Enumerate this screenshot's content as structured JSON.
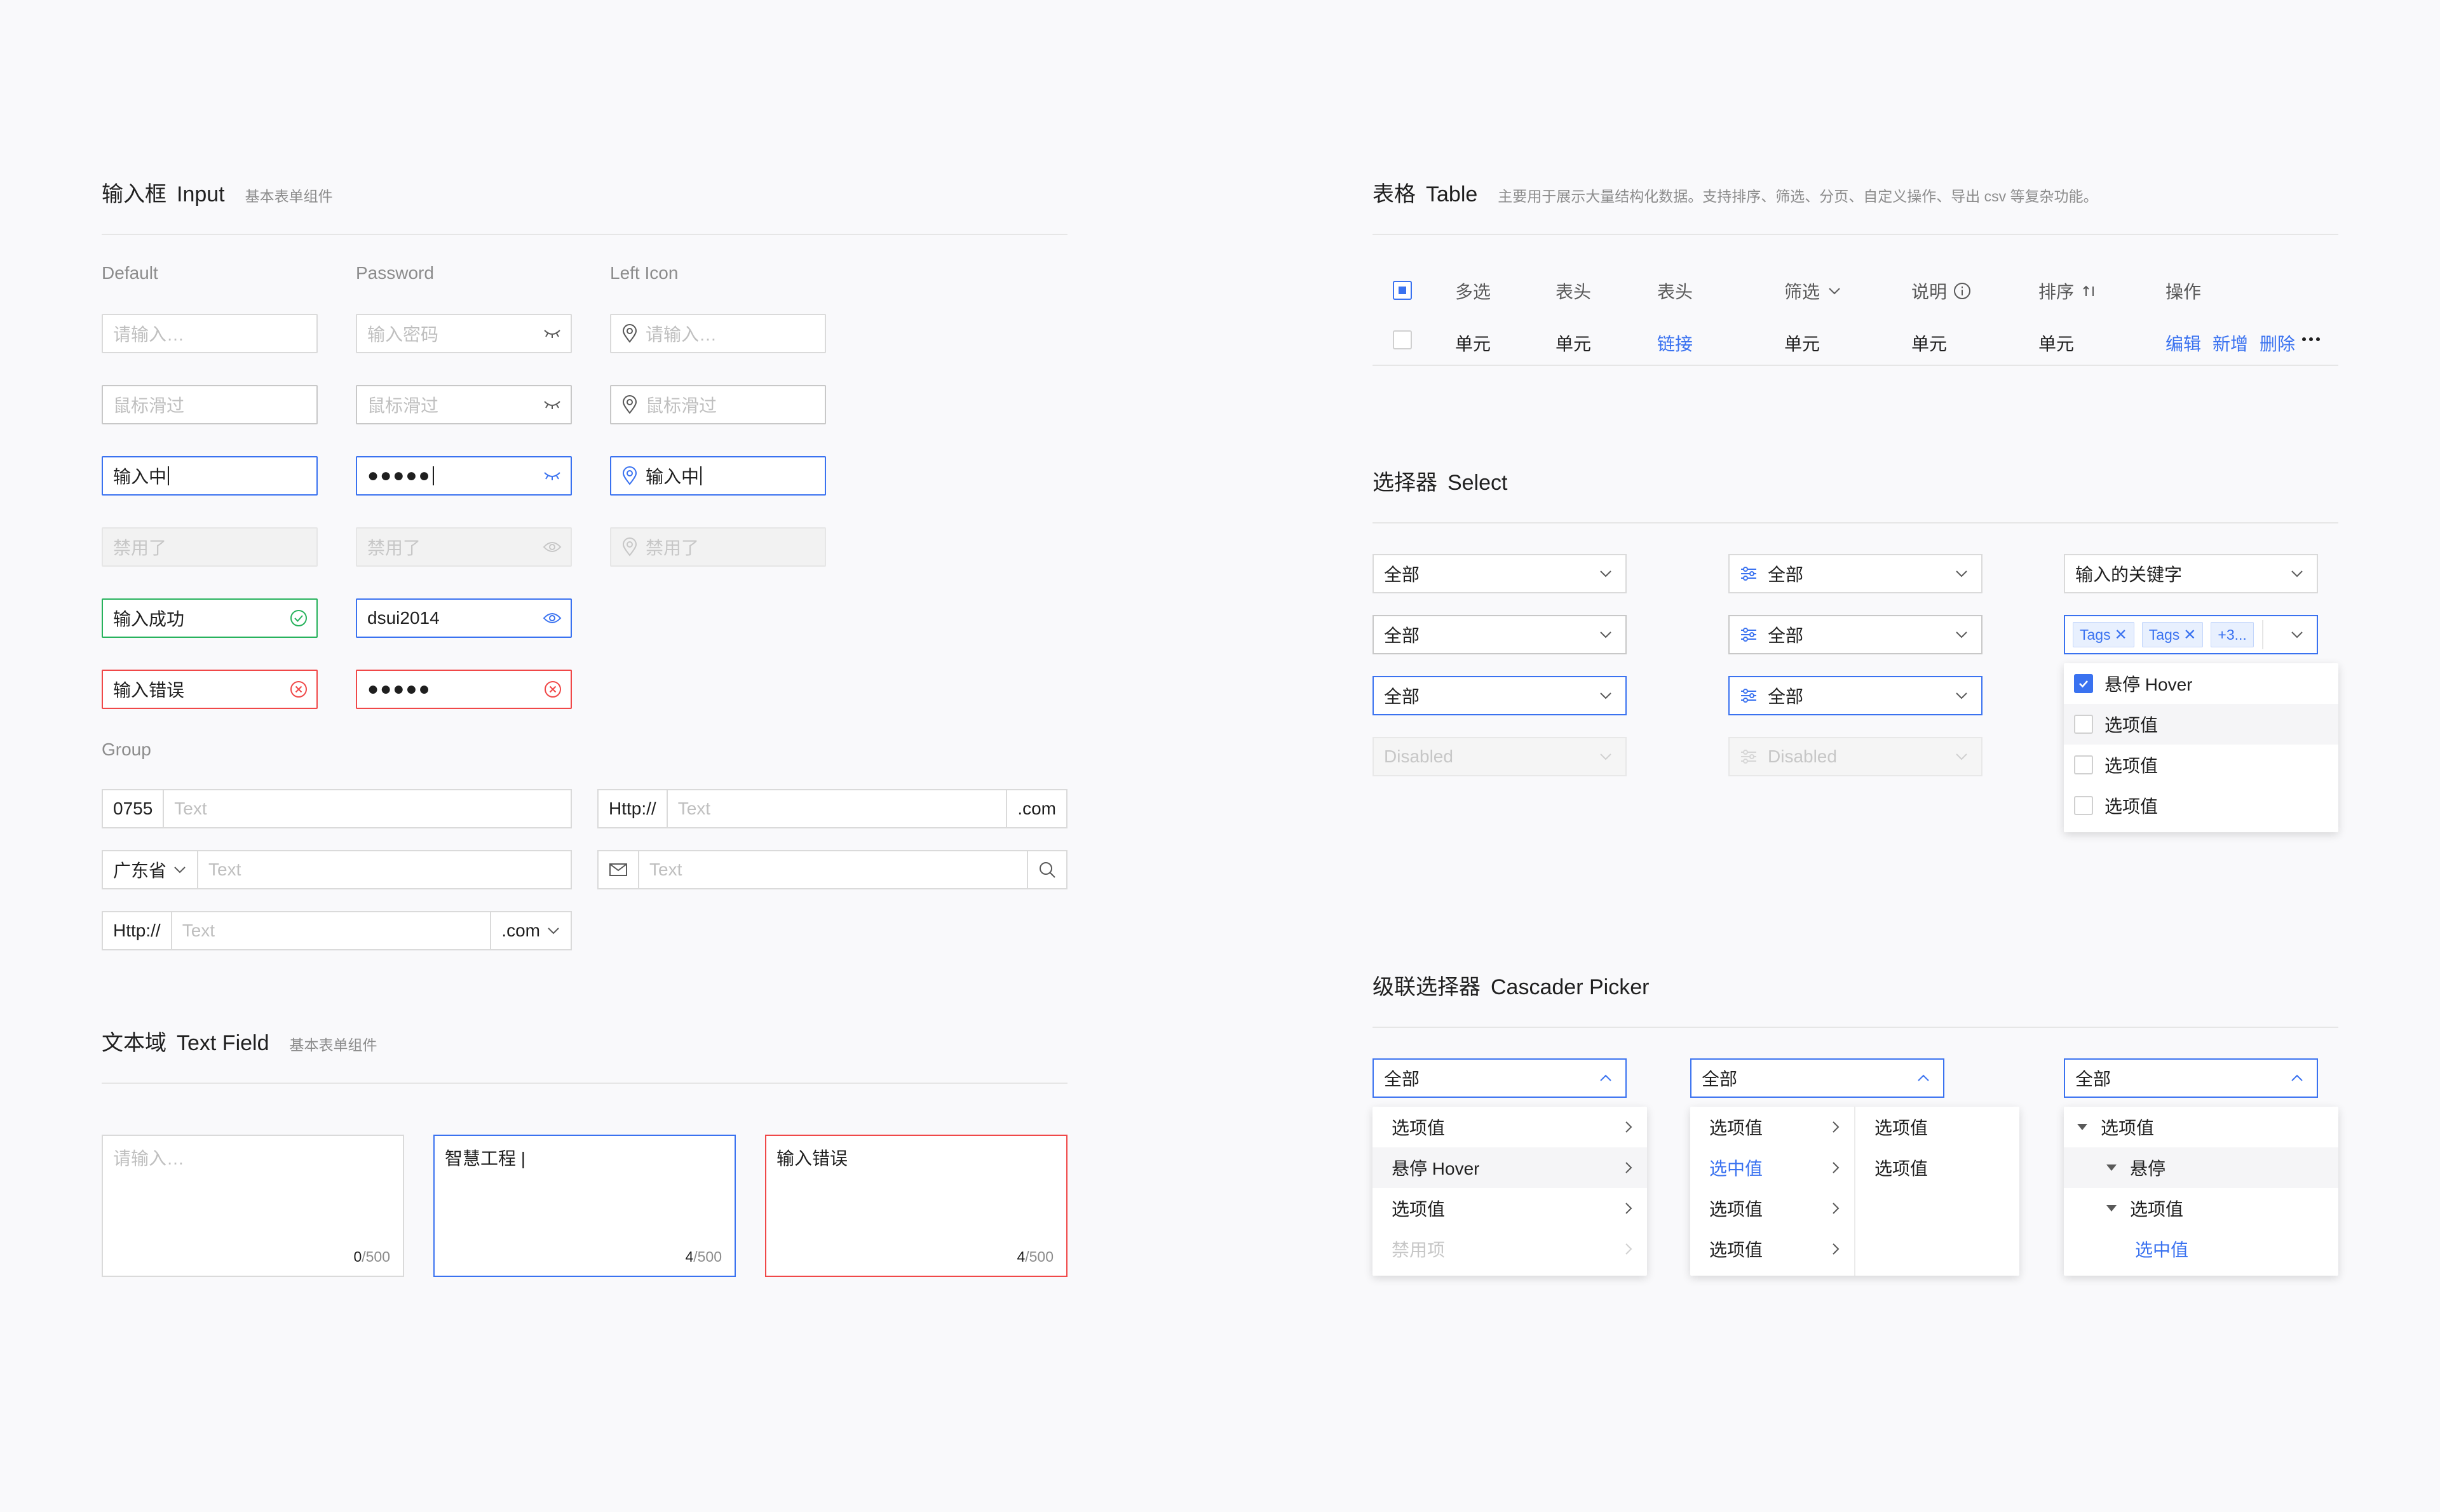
{
  "input": {
    "title": "输入框",
    "title_en": "Input",
    "desc": "基本表单组件",
    "col_default": "Default",
    "col_password": "Password",
    "col_lefticon": "Left Icon",
    "r1": {
      "a": "请输入…",
      "b": "输入密码",
      "c": "请输入…"
    },
    "r2": {
      "a": "鼠标滑过",
      "b": "鼠标滑过",
      "c": "鼠标滑过"
    },
    "r3": {
      "a": "输入中",
      "b": "●●●●●",
      "c": "输入中"
    },
    "r4": {
      "a": "禁用了",
      "b": "禁用了",
      "c": "禁用了"
    },
    "r5": {
      "a": "输入成功",
      "b": "dsui2014"
    },
    "r6": {
      "a": "输入错误",
      "b": "●●●●●"
    },
    "group_label": "Group",
    "g1": {
      "prefix": "0755",
      "ph": "Text"
    },
    "g2": {
      "prefix": "Http://",
      "ph": "Text",
      "suffix": ".com"
    },
    "g3": {
      "prefix": "广东省",
      "ph": "Text"
    },
    "g4": {
      "ph": "Text"
    },
    "g5": {
      "prefix": "Http://",
      "ph": "Text",
      "suffix": ".com"
    }
  },
  "textfield": {
    "title": "文本域",
    "title_en": "Text Field",
    "desc": "基本表单组件",
    "a": {
      "ph": "请输入…",
      "count": "0",
      "max": "/500"
    },
    "b": {
      "value": "智慧工程 |",
      "count": "4",
      "max": "/500"
    },
    "c": {
      "value": "输入错误",
      "count": "4",
      "max": "/500"
    }
  },
  "table": {
    "title": "表格",
    "title_en": "Table",
    "desc": "主要用于展示大量结构化数据。支持排序、筛选、分页、自定义操作、导出 csv 等复杂功能。",
    "headers": [
      "多选",
      "表头",
      "表头",
      "筛选",
      "说明",
      "排序",
      "操作"
    ],
    "row": {
      "c1": "单元",
      "c2": "单元",
      "c3": "链接",
      "c4": "单元",
      "c5": "单元",
      "c6": "单元",
      "a1": "编辑",
      "a2": "新增",
      "a3": "删除"
    }
  },
  "select": {
    "title": "选择器",
    "title_en": "Select",
    "col1": [
      "全部",
      "全部",
      "全部",
      "Disabled"
    ],
    "col2": [
      "全部",
      "全部",
      "全部",
      "Disabled"
    ],
    "keyword": "输入的关键字",
    "tags": [
      "Tags",
      "Tags",
      "+3..."
    ],
    "options": [
      "悬停 Hover",
      "选项值",
      "选项值",
      "选项值"
    ]
  },
  "cascader": {
    "title": "级联选择器",
    "title_en": "Cascader Picker",
    "value": "全部",
    "p1": [
      "选项值",
      "悬停 Hover",
      "选项值",
      "禁用项"
    ],
    "p2a": [
      "选项值",
      "选中值",
      "选项值",
      "选项值"
    ],
    "p2b": [
      "选项值",
      "选项值"
    ],
    "p3": [
      "选项值",
      "悬停",
      "选项值",
      "选中值"
    ]
  },
  "colors": {
    "primary": "#3A72F0",
    "success": "#27B25C",
    "error": "#F04848",
    "border": "#DADADA"
  }
}
